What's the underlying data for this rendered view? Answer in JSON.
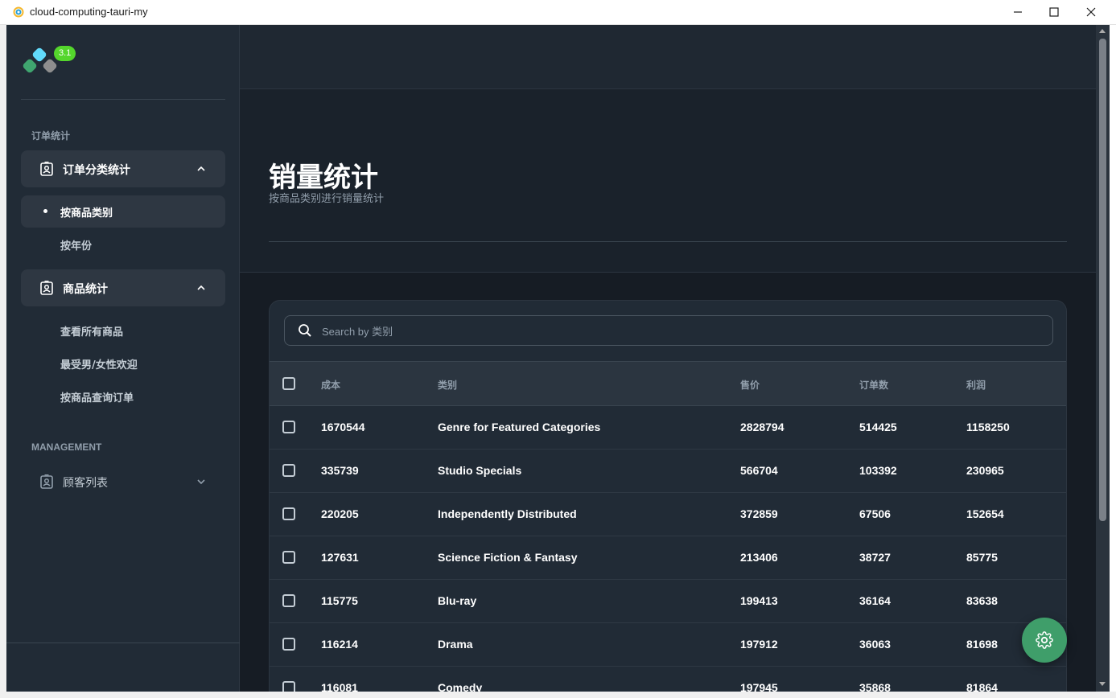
{
  "window": {
    "title": "cloud-computing-tauri-my"
  },
  "logo": {
    "version": "3.1"
  },
  "sidebar": {
    "section_orders": "订单统计",
    "group_order_category": {
      "label": "订单分类统计",
      "icon": "contact-card-icon"
    },
    "items_orders": [
      "按商品类别",
      "按年份"
    ],
    "group_products": {
      "label": "商品统计",
      "icon": "contact-card-icon"
    },
    "items_products": [
      "查看所有商品",
      "最受男/女性欢迎",
      "按商品查询订单"
    ],
    "section_management": "MANAGEMENT",
    "group_customers": {
      "label": "顾客列表",
      "icon": "contact-card-icon"
    }
  },
  "header": {
    "title": "销量统计",
    "subtitle": "按商品类别进行销量统计"
  },
  "search": {
    "placeholder": "Search by 类别"
  },
  "table": {
    "columns": [
      "成本",
      "类别",
      "售价",
      "订单数",
      "利润"
    ],
    "rows": [
      [
        "1670544",
        "Genre for Featured Categories",
        "2828794",
        "514425",
        "1158250"
      ],
      [
        "335739",
        "Studio Specials",
        "566704",
        "103392",
        "230965"
      ],
      [
        "220205",
        "Independently Distributed",
        "372859",
        "67506",
        "152654"
      ],
      [
        "127631",
        "Science Fiction & Fantasy",
        "213406",
        "38727",
        "85775"
      ],
      [
        "115775",
        "Blu-ray",
        "199413",
        "36164",
        "83638"
      ],
      [
        "116214",
        "Drama",
        "197912",
        "36063",
        "81698"
      ],
      [
        "116081",
        "Comedy",
        "197945",
        "35868",
        "81864"
      ]
    ]
  },
  "colors": {
    "accent_green": "#3f9e6a",
    "badge_green": "#54d62c",
    "background": "#161c24",
    "sidebar": "#212b36"
  }
}
